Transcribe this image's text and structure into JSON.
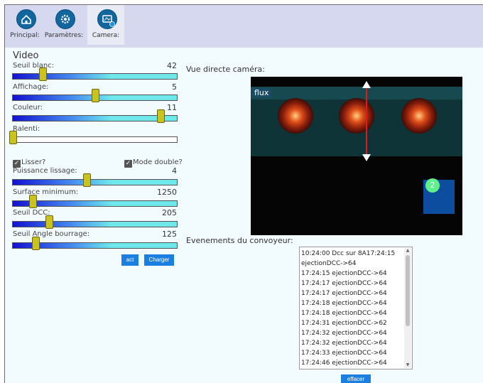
{
  "tabs": [
    {
      "label": "Principal:",
      "icon": "home-icon"
    },
    {
      "label": "Paramètres:",
      "icon": "gear-icon"
    },
    {
      "label": "Camera:",
      "icon": "camera-icon"
    }
  ],
  "video": {
    "title": "Video",
    "sliders": [
      {
        "label": "Seuil blanc:",
        "value": "42",
        "fraction": 0.18
      },
      {
        "label": "Affichage:",
        "value": "5",
        "fraction": 0.5
      },
      {
        "label": "Couleur:",
        "value": "11",
        "fraction": 0.9
      },
      {
        "label": "Ralenti:",
        "value": "",
        "fraction": 0.0
      }
    ],
    "checks": {
      "smooth": "Lisser?",
      "double": "Mode double?"
    },
    "sliders2": [
      {
        "label": "Puissance lissage:",
        "value": "4",
        "fraction": 0.45
      },
      {
        "label": "Surface minimum:",
        "value": "1250",
        "fraction": 0.12
      },
      {
        "label": "Seuil DCC:",
        "value": "205",
        "fraction": 0.22
      },
      {
        "label": "Seuil Angle bourrage:",
        "value": "125",
        "fraction": 0.14
      }
    ],
    "buttons": {
      "act": "act",
      "load": "Charger"
    }
  },
  "camera": {
    "title": "Vue directe caméra:",
    "flux_label": "flux",
    "target_id": "2"
  },
  "events": {
    "title": "Evenements du convoyeur:",
    "items": [
      "10:24:00 Dcc sur 8A17:24:15",
      "ejectionDCC->64",
      "17:24:15 ejectionDCC->64",
      "17:24:17 ejectionDCC->64",
      "17:24:17 ejectionDCC->64",
      "17:24:18 ejectionDCC->64",
      "17:24:18 ejectionDCC->64",
      "17:24:31 ejectionDCC->62",
      "17:24:32 ejectionDCC->64",
      "17:24:32 ejectionDCC->64",
      "17:24:33 ejectionDCC->64",
      "17:24:46 ejectionDCC->64"
    ],
    "clear_label": "effacer"
  }
}
